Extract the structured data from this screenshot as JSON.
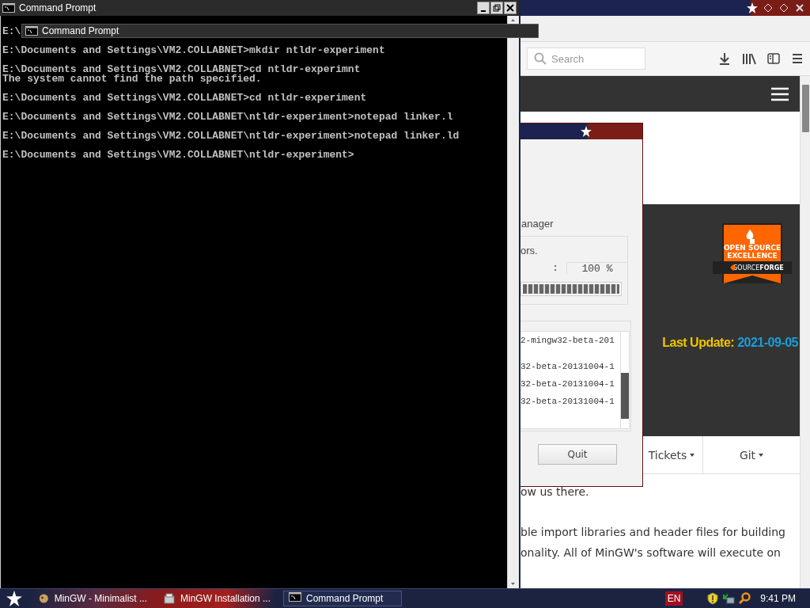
{
  "cmd": {
    "title": "Command Prompt",
    "tooltip": "Command Prompt",
    "lines": [
      {
        "kind": "prompt",
        "text": "E:\\"
      },
      {
        "kind": "prompt",
        "text": "E:\\Documents and Settings\\VM2.COLLABNET>mkdir ntldr-experiment"
      },
      {
        "kind": "prompt",
        "text": "E:\\Documents and Settings\\VM2.COLLABNET>cd ntldr-experimnt"
      },
      {
        "kind": "output",
        "text": "The system cannot find the path specified."
      },
      {
        "kind": "prompt",
        "text": "E:\\Documents and Settings\\VM2.COLLABNET>cd ntldr-experiment"
      },
      {
        "kind": "prompt",
        "text": "E:\\Documents and Settings\\VM2.COLLABNET\\ntldr-experiment>notepad linker.l"
      },
      {
        "kind": "prompt",
        "text": "E:\\Documents and Settings\\VM2.COLLABNET\\ntldr-experiment>notepad linker.ld"
      },
      {
        "kind": "prompt",
        "text": "E:\\Documents and Settings\\VM2.COLLABNET\\ntldr-experiment>"
      }
    ]
  },
  "browser": {
    "search": {
      "placeholder": "Search"
    },
    "badge": {
      "line1": "OPEN SOURCE",
      "line2": "EXCELLENCE",
      "brand_a": "SOURCE",
      "brand_b": "FORGE"
    },
    "last_update_label": "Last Update:",
    "last_update_value": "2021-09-05",
    "nav": [
      {
        "label": "Tickets"
      },
      {
        "label": "Git"
      }
    ],
    "paragraphs": [
      "ow us there.",
      "ble import libraries and header files for building",
      "onality. All of MinGW's software will execute on"
    ]
  },
  "installer": {
    "heading": "anager",
    "status": "ors.",
    "colon": ":",
    "percent": "100 %",
    "progress": {
      "level": 1
    },
    "log": [
      "2-mingw32-beta-201",
      "32-beta-20131004-1",
      "32-beta-20131004-1",
      "32-beta-20131004-1"
    ],
    "button": "Quit"
  },
  "taskbar": {
    "tasks": [
      {
        "label": "MinGW - Minimalist ...",
        "selected": false
      },
      {
        "label": "MinGW Installation ...",
        "selected": false
      },
      {
        "label": "Command Prompt",
        "selected": true
      }
    ],
    "language": "EN",
    "clock": "9:41 PM"
  }
}
